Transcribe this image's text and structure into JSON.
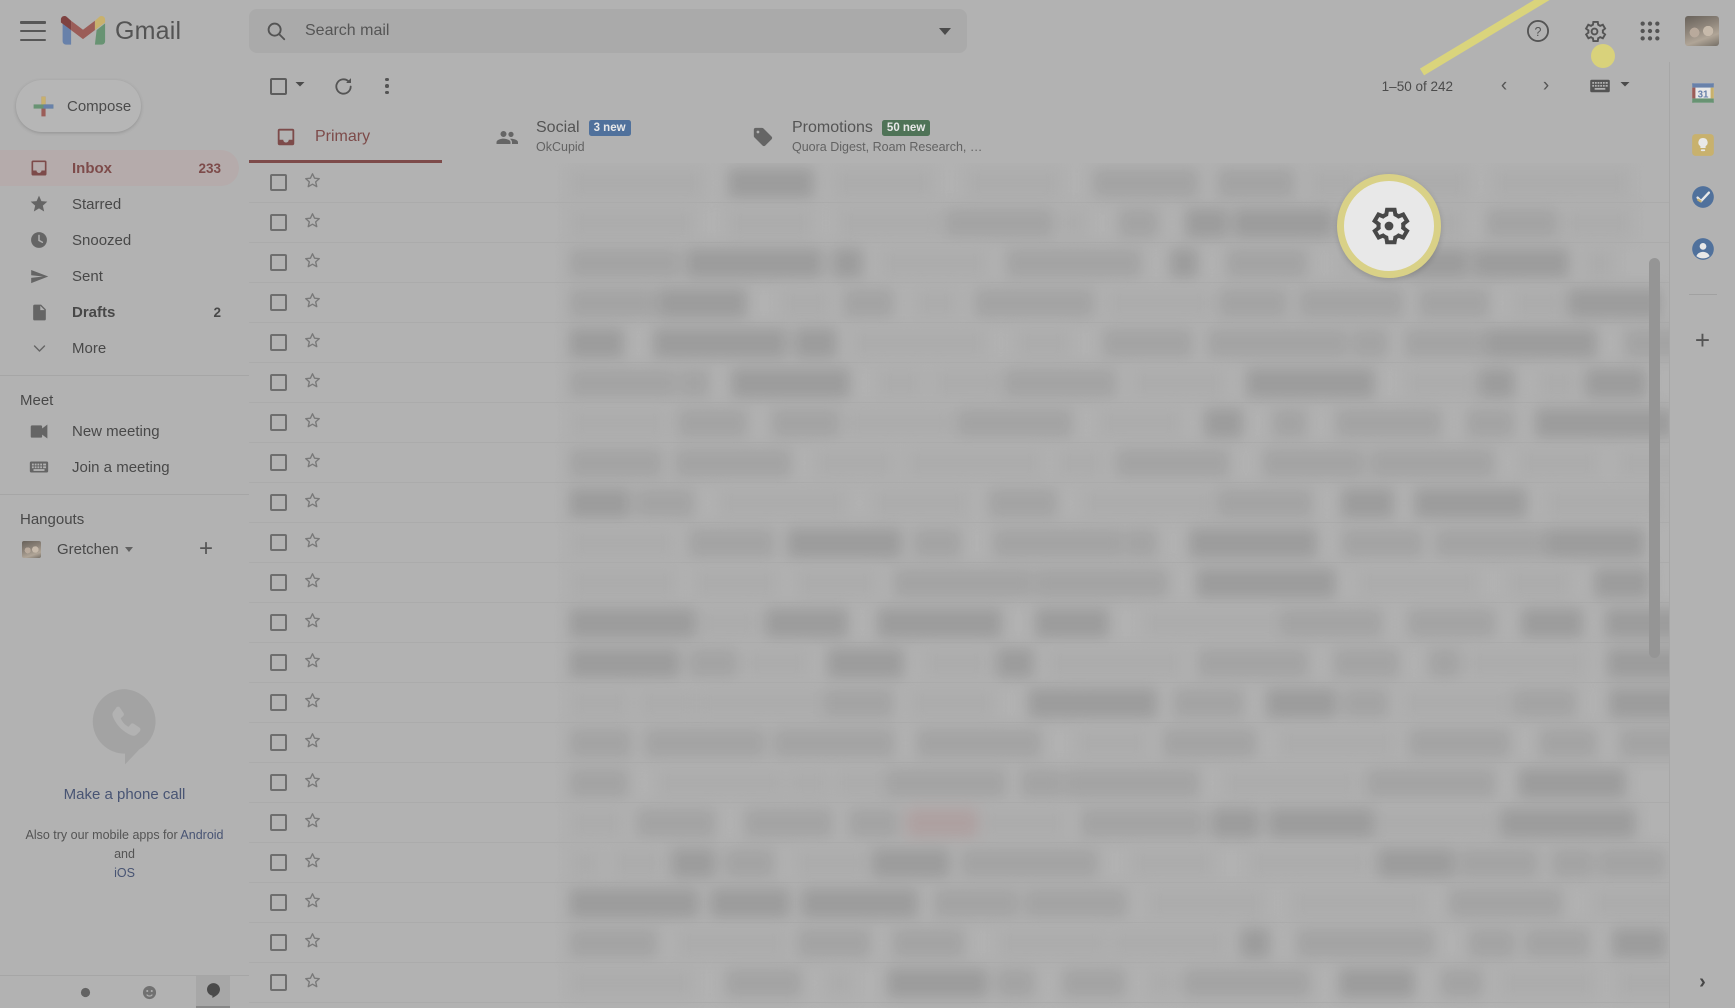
{
  "app": {
    "brand": "Gmail"
  },
  "header": {
    "menu_icon": "hamburger-menu-icon",
    "logo_icon": "gmail-logo-icon",
    "search": {
      "placeholder": "Search mail",
      "value": "",
      "icon": "search-icon",
      "options_icon": "show-search-options-icon"
    },
    "help_icon": "help-question-icon",
    "settings_icon": "gear-settings-icon",
    "apps_icon": "google-apps-grid-icon",
    "avatar_icon": "account-avatar"
  },
  "sidebar": {
    "compose_label": "Compose",
    "compose_icon": "plus-compose-icon",
    "items": [
      {
        "label": "Inbox",
        "count": "233",
        "icon": "inbox-icon",
        "active": true,
        "bold": true
      },
      {
        "label": "Starred",
        "count": "",
        "icon": "star-icon",
        "active": false,
        "bold": false
      },
      {
        "label": "Snoozed",
        "count": "",
        "icon": "clock-icon",
        "active": false,
        "bold": false
      },
      {
        "label": "Sent",
        "count": "",
        "icon": "send-icon",
        "active": false,
        "bold": false
      },
      {
        "label": "Drafts",
        "count": "2",
        "icon": "document-icon",
        "active": false,
        "bold": true
      },
      {
        "label": "More",
        "count": "",
        "icon": "chevron-down-icon",
        "active": false,
        "bold": false
      }
    ],
    "meet": {
      "title": "Meet",
      "items": [
        {
          "label": "New meeting",
          "icon": "video-camera-icon"
        },
        {
          "label": "Join a meeting",
          "icon": "keyboard-icon"
        }
      ]
    },
    "hangouts": {
      "title": "Hangouts",
      "user": "Gretchen",
      "user_caret_icon": "chevron-down-icon",
      "add_icon": "plus-icon",
      "avatar_icon": "contact-avatar"
    },
    "promo": {
      "phone_icon": "phone-call-icon",
      "phone_link": "Make a phone call",
      "text_before": "Also try our mobile apps for ",
      "android_link": "Android",
      "text_mid": " and",
      "ios_link": "iOS"
    },
    "status_icons": [
      "status-available-icon",
      "emoji-face-icon",
      "hangouts-icon"
    ]
  },
  "toolbar": {
    "select_all_icon": "select-all-checkbox",
    "select_caret_icon": "chevron-down-icon",
    "refresh_icon": "refresh-icon",
    "more_icon": "more-options-kebab-icon",
    "page_range": "1–50 of 242",
    "prev_icon": "chevron-left-icon",
    "next_icon": "chevron-right-icon",
    "input_tools_icon": "keyboard-input-tools-icon",
    "input_tools_caret_icon": "chevron-down-icon"
  },
  "tabs": [
    {
      "label": "Primary",
      "icon": "inbox-tab-icon",
      "badge": "",
      "badge_color": "",
      "subtitle": "",
      "selected": true
    },
    {
      "label": "Social",
      "icon": "people-tab-icon",
      "badge": "3 new",
      "badge_color": "#1a73e8",
      "subtitle": "OkCupid",
      "selected": false
    },
    {
      "label": "Promotions",
      "icon": "tag-tab-icon",
      "badge": "50 new",
      "badge_color": "#1e7e34",
      "subtitle": "Quora Digest, Roam Research, …",
      "selected": false
    }
  ],
  "maillist": {
    "row_checkbox_icon": "row-checkbox",
    "row_star_icon": "star-icon",
    "row_count": 21,
    "scrollbar_icon": "vertical-scrollbar"
  },
  "right_rail": {
    "items": [
      {
        "icon": "google-calendar-icon"
      },
      {
        "icon": "google-keep-icon"
      },
      {
        "icon": "google-tasks-icon"
      },
      {
        "icon": "google-contacts-icon"
      }
    ],
    "add_icon": "add-on-plus-icon",
    "expand_icon": "chevron-right-icon"
  },
  "callout": {
    "target_icon": "gear-settings-icon",
    "ring_color": "#ffe81f",
    "dot_color": "#ffeb00"
  },
  "colors": {
    "accent_red": "#b7302c",
    "link_blue": "#2a4ba0",
    "highlight_yellow": "#ffe81f",
    "social_badge": "#1a73e8",
    "promotions_badge": "#1e7e34"
  }
}
